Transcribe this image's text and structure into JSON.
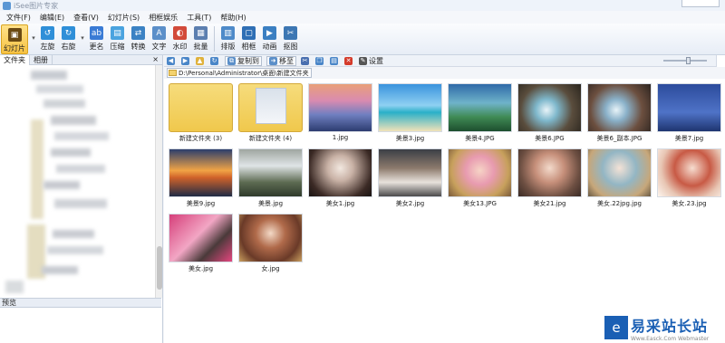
{
  "window": {
    "title": "iSee图片专家"
  },
  "menu": [
    "文件(F)",
    "编辑(E)",
    "查看(V)",
    "幻灯片(S)",
    "相框娱乐",
    "工具(T)",
    "帮助(H)"
  ],
  "toolbar": [
    {
      "label": "幻灯片",
      "icon": "slideshow-icon",
      "color": "#6b4a12"
    },
    {
      "label": "左旋",
      "icon": "rotate-left-icon",
      "color": "#2f8fd8"
    },
    {
      "label": "右旋",
      "icon": "rotate-right-icon",
      "color": "#2f8fd8"
    },
    {
      "label": "更名",
      "icon": "rename-icon",
      "color": "#3a7bd5"
    },
    {
      "label": "压缩",
      "icon": "compress-icon",
      "color": "#4aa3df"
    },
    {
      "label": "转换",
      "icon": "convert-icon",
      "color": "#3b82c4"
    },
    {
      "label": "文字",
      "icon": "text-icon",
      "color": "#5b8fc9"
    },
    {
      "label": "水印",
      "icon": "watermark-icon",
      "color": "#d24a3a"
    },
    {
      "label": "批量",
      "icon": "batch-icon",
      "color": "#5c7fb0"
    },
    {
      "label": "排版",
      "icon": "layout-icon",
      "color": "#4e8ac9"
    },
    {
      "label": "相框",
      "icon": "frame-icon",
      "color": "#2f6fb5"
    },
    {
      "label": "动画",
      "icon": "animation-icon",
      "color": "#3b7fc2"
    },
    {
      "label": "抠图",
      "icon": "cutout-icon",
      "color": "#3d77b3"
    }
  ],
  "sidebar": {
    "tab_folders": "文件夹",
    "tab_albums": "相册",
    "close": "×",
    "preview_label": "预览"
  },
  "browser_toolbar": {
    "copy_to": "复制到",
    "move_to": "移至",
    "settings": "设置"
  },
  "address": "D:\\Personal\\Administrator\\桌面\\新建文件夹",
  "files": [
    {
      "name": "新建文件夹 (3)",
      "kind": "folder"
    },
    {
      "name": "新建文件夹 (4)",
      "kind": "folder-photo"
    },
    {
      "name": "1.jpg",
      "kind": "photo"
    },
    {
      "name": "美景3.jpg",
      "kind": "photo"
    },
    {
      "name": "美景4.JPG",
      "kind": "photo"
    },
    {
      "name": "美景6.JPG",
      "kind": "photo"
    },
    {
      "name": "美景6_副本.JPG",
      "kind": "photo"
    },
    {
      "name": "美景7.jpg",
      "kind": "photo"
    },
    {
      "name": "美景9.jpg",
      "kind": "photo"
    },
    {
      "name": "美景.jpg",
      "kind": "photo"
    },
    {
      "name": "美女1.jpg",
      "kind": "photo"
    },
    {
      "name": "美女2.jpg",
      "kind": "photo"
    },
    {
      "name": "美女13.JPG",
      "kind": "photo"
    },
    {
      "name": "美女21.jpg",
      "kind": "photo"
    },
    {
      "name": "美女.22jpg.jpg",
      "kind": "photo"
    },
    {
      "name": "美女.23.jpg",
      "kind": "photo"
    },
    {
      "name": "美女.jpg",
      "kind": "photo"
    },
    {
      "name": "女.jpg",
      "kind": "photo"
    }
  ],
  "watermark": {
    "logo": "e",
    "name": "易采站长站",
    "sub": "Www.Easck.Com Webmaster"
  }
}
